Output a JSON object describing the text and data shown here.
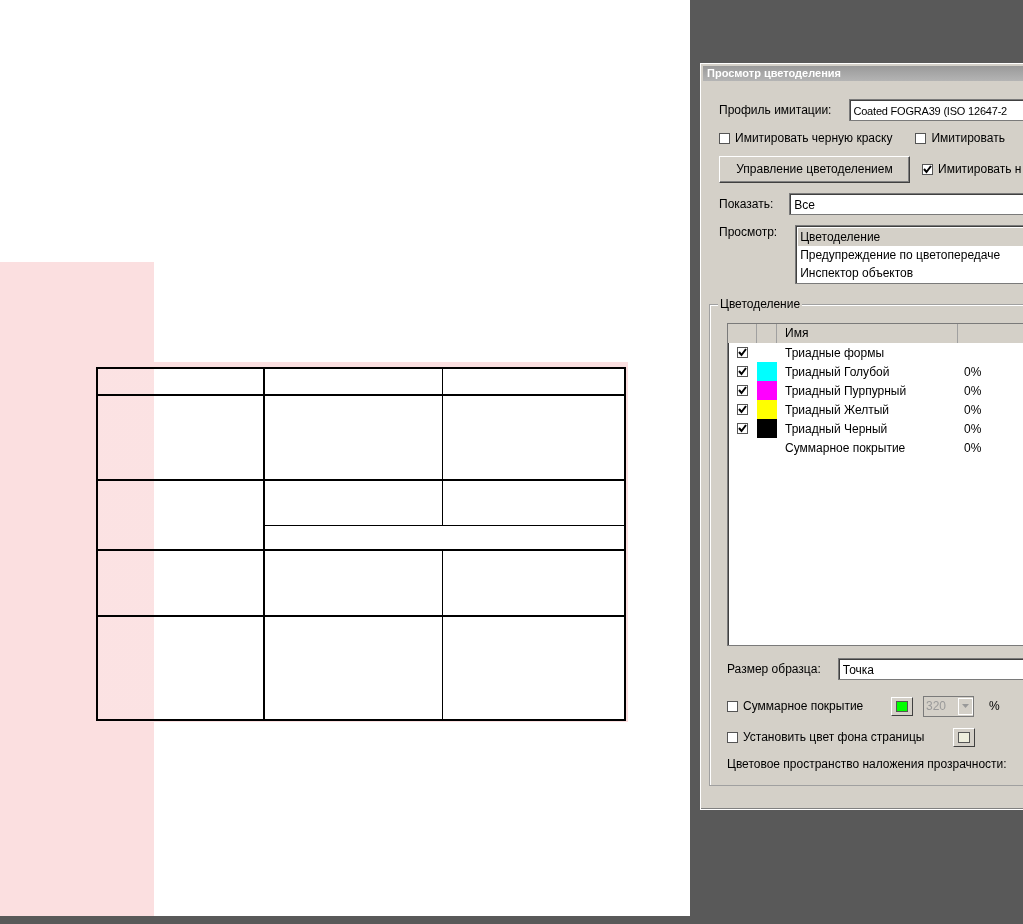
{
  "document": {
    "table": {
      "rows": [
        {
          "kind": "normal"
        },
        {
          "kind": "normal"
        },
        {
          "kind": "split"
        },
        {
          "kind": "normal"
        },
        {
          "kind": "normal"
        }
      ]
    }
  },
  "dialog": {
    "title": "Просмотр цветоделения",
    "profile": {
      "label": "Профиль имитации:",
      "value": "Coated FOGRA39 (ISO 12647-2"
    },
    "options": [
      {
        "label": "Имитировать черную краску",
        "checked": false
      },
      {
        "label": "Имитировать",
        "checked": false
      }
    ],
    "manage_button": "Управление цветоделением",
    "option_3": {
      "label": "Имитировать н",
      "checked": true
    },
    "show": {
      "label": "Показать:",
      "value": "Все"
    },
    "preview": {
      "label": "Просмотр:",
      "items": [
        {
          "label": "Цветоделение",
          "selected": true
        },
        {
          "label": "Предупреждение по цветопередаче",
          "selected": false
        },
        {
          "label": "Инспектор объектов",
          "selected": false
        }
      ]
    },
    "separations": {
      "title": "Цветоделение",
      "columns": [
        "Имя"
      ],
      "rows": [
        {
          "kind": "ink",
          "checked": true,
          "name": "Триадные формы"
        },
        {
          "kind": "ink",
          "checked": true,
          "color": "#00ffff",
          "name": "Триадный Голубой",
          "value": "0%"
        },
        {
          "kind": "ink",
          "checked": true,
          "color": "#ff00ff",
          "name": "Триадный Пурпурный",
          "value": "0%"
        },
        {
          "kind": "ink",
          "checked": true,
          "color": "#ffff00",
          "name": "Триадный Желтый",
          "value": "0%"
        },
        {
          "kind": "ink",
          "checked": true,
          "color": "#000000",
          "name": "Триадный Черный",
          "value": "0%"
        },
        {
          "kind": "total",
          "name": "Суммарное покрытие",
          "value": "0%"
        }
      ]
    },
    "sample_size": {
      "label": "Размер образца:",
      "value": "Точка"
    },
    "total_coverage": {
      "label": "Суммарное покрытие",
      "checked": false,
      "color": "#00ff00",
      "value": "320",
      "disabled": true,
      "unit": "%"
    },
    "page_bg": {
      "label": "Установить цвет фона страницы",
      "checked": false,
      "color": "#eeeedd"
    },
    "blend_space": {
      "label": "Цветовое пространство наложения прозрачности:"
    }
  }
}
